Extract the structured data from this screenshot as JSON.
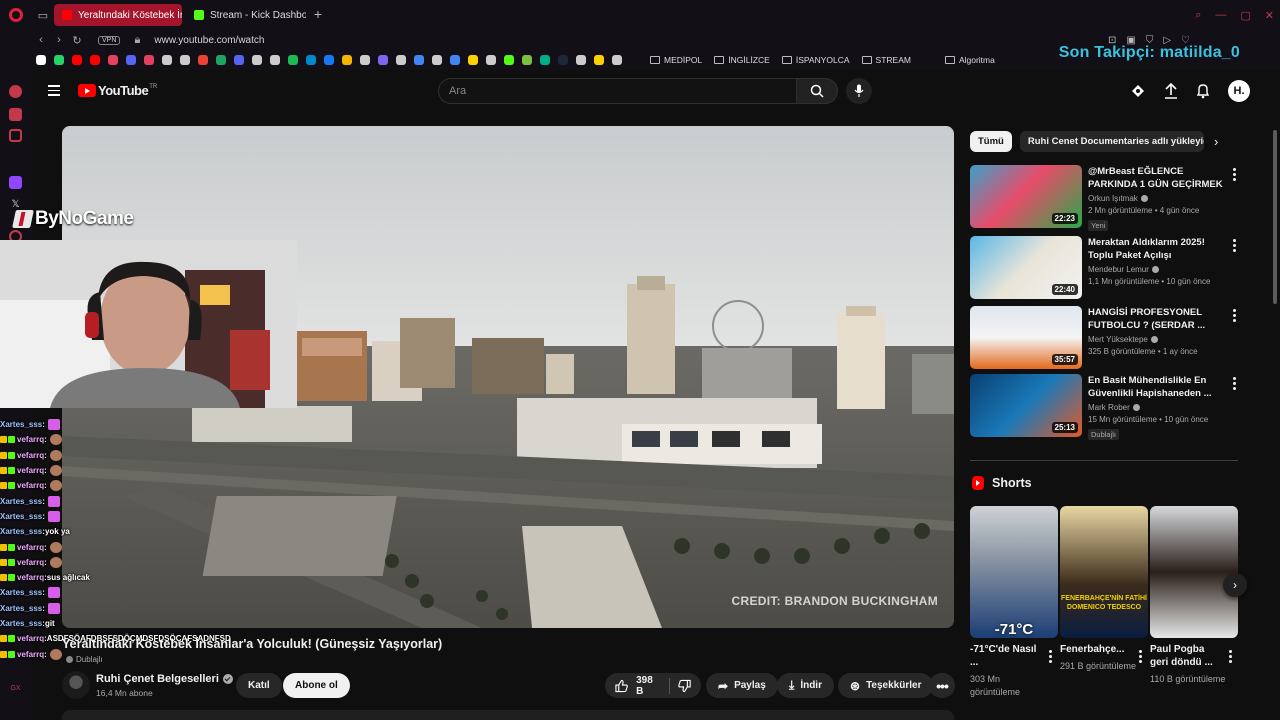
{
  "browser": {
    "tabs": [
      {
        "label": "Yeraltındaki Köstebek İnsa",
        "active": true
      },
      {
        "label": "Stream - Kick Dashboard",
        "active": false
      }
    ],
    "vpn_label": "VPN",
    "url": "www.youtube.com/watch",
    "bookmark_folders": [
      "MEDİPOL",
      "İNGİLİZCE",
      "İSPANYOLCA",
      "STREAM"
    ],
    "bookmark_extra": "Algoritma"
  },
  "stream_overlay": {
    "follower_text": "Son Takipçi: matiilda_0",
    "sponsor_logo_text": "ByNoGame",
    "chat": [
      {
        "user": "Xartes_sss",
        "text": "",
        "emote": "pink",
        "badge": false
      },
      {
        "user": "vefarrq",
        "text": "",
        "emote": "face",
        "badge": true
      },
      {
        "user": "vefarrq",
        "text": "",
        "emote": "face",
        "badge": true
      },
      {
        "user": "vefarrq",
        "text": "",
        "emote": "face",
        "badge": true
      },
      {
        "user": "vefarrq",
        "text": "",
        "emote": "face",
        "badge": true
      },
      {
        "user": "Xartes_sss",
        "text": "",
        "emote": "pink",
        "badge": false
      },
      {
        "user": "Xartes_sss",
        "text": "",
        "emote": "pink",
        "badge": false
      },
      {
        "user": "Xartes_sss",
        "text": "yok ya",
        "emote": "",
        "badge": false
      },
      {
        "user": "vefarrq",
        "text": "",
        "emote": "face",
        "badge": true
      },
      {
        "user": "vefarrq",
        "text": "",
        "emote": "face",
        "badge": true
      },
      {
        "user": "vefarrq",
        "text": "sus ağlıcak",
        "emote": "",
        "badge": true
      },
      {
        "user": "Xartes_sss",
        "text": "",
        "emote": "pink",
        "badge": false
      },
      {
        "user": "Xartes_sss",
        "text": "",
        "emote": "pink",
        "badge": false
      },
      {
        "user": "Xartes_sss",
        "text": "git",
        "emote": "",
        "badge": false
      },
      {
        "user": "vefarrq",
        "text": "ASDFSÖAFDBSFSDÖÇMDSFDSÖÇAFSADNFSD",
        "emote": "",
        "badge": true
      },
      {
        "user": "vefarrq",
        "text": "",
        "emote": "face",
        "badge": true
      }
    ]
  },
  "youtube": {
    "logo_text": "YouTube",
    "logo_country": "TR",
    "search_placeholder": "Ara",
    "avatar_letter": "H.",
    "video": {
      "credit": "CREDIT: BRANDON BUCKINGHAM",
      "title": "Yeraltındaki Köstebek İnsanlar'a Yolculuk! (Güneşsiz Yaşıyorlar)",
      "dubbed": "Dublajlı",
      "channel": "Ruhi Çenet Belgeselleri",
      "subscribers": "16,4 Mn abone",
      "join": "Katıl",
      "subscribe": "Abone ol",
      "likes": "398 B",
      "share": "Paylaş",
      "download": "İndir",
      "thanks": "Teşekkürler"
    },
    "chips": [
      "Tümü",
      "Ruhi Cenet Documentaries adlı yükleyiciden"
    ],
    "recommendations": [
      {
        "title": "@MrBeast  EĞLENCE PARKINDA 1 GÜN GEÇİRMEK",
        "channel": "Orkun Işıtmak",
        "meta": "2 Mn görüntüleme • 4 gün önce",
        "tag": "Yeni",
        "duration": "22:23"
      },
      {
        "title": "Meraktan Aldıklarım 2025! Toplu Paket Açılışı",
        "channel": "Mendebur Lemur",
        "meta": "1,1 Mn görüntüleme • 10 gün önce",
        "tag": "",
        "duration": "22:40"
      },
      {
        "title": "HANGİSİ PROFESYONEL FUTBOLCU ? (SERDAR ...",
        "channel": "Mert Yüksektepe",
        "meta": "325 B görüntüleme • 1 ay önce",
        "tag": "",
        "duration": "35:57"
      },
      {
        "title": "En Basit Mühendislikle En Güvenlikli Hapishaneden ...",
        "channel": "Mark Rober",
        "meta": "15 Mn görüntüleme • 10 gün önce",
        "tag": "Dublajlı",
        "duration": "25:13"
      }
    ],
    "shorts_title": "Shorts",
    "shorts": [
      {
        "title": "-71°C'de Nasıl ...",
        "views": "303 Mn görüntüleme",
        "overlay": "-71°C"
      },
      {
        "title": "Fenerbahçe...",
        "views": "291 B görüntüleme",
        "overlay": "FENERBAHÇE'NİN FATİHİ DOMENICO TEDESCO"
      },
      {
        "title": "Paul Pogba geri döndü ...",
        "views": "110 B görüntüleme",
        "overlay": ""
      }
    ]
  }
}
